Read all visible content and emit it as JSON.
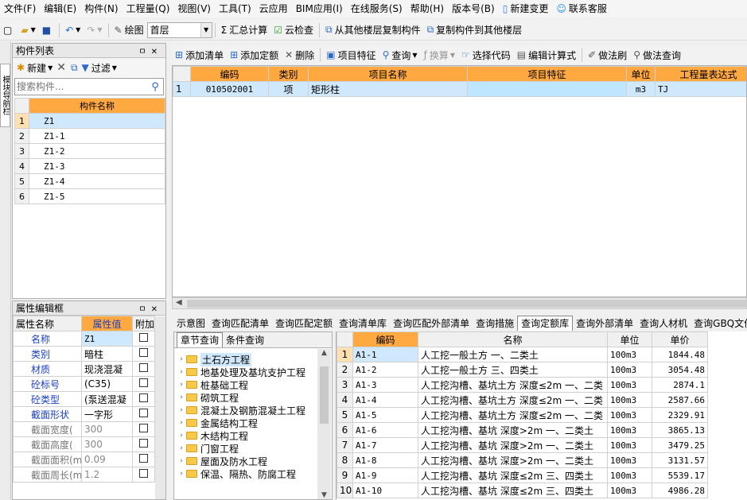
{
  "menu": [
    {
      "label": "文件(F)"
    },
    {
      "label": "编辑(E)"
    },
    {
      "label": "构件(N)"
    },
    {
      "label": "工程量(Q)"
    },
    {
      "label": "视图(V)"
    },
    {
      "label": "工具(T)"
    },
    {
      "label": "云应用"
    },
    {
      "label": "BIM应用(I)"
    },
    {
      "label": "在线服务(S)"
    },
    {
      "label": "帮助(H)"
    },
    {
      "label": "版本号(B)"
    },
    {
      "label": "新建变更",
      "icon": "document-icon"
    },
    {
      "label": "联系客服",
      "icon": "service-icon"
    }
  ],
  "toolbar1": {
    "draw_label": "绘图",
    "floor_value": "首层",
    "sum_label": "汇总计算",
    "cloud_check_label": "云检查",
    "copy_from_label": "从其他楼层复制构件",
    "copy_to_label": "复制构件到其他楼层"
  },
  "left_tab": {
    "label": "模块导航栏"
  },
  "component_list": {
    "title": "构件列表",
    "new_label": "新建",
    "filter_label": "过滤",
    "search_placeholder": "搜索构件...",
    "header": "构件名称",
    "rows": [
      {
        "n": "1",
        "name": "Z1"
      },
      {
        "n": "2",
        "name": "Z1-1"
      },
      {
        "n": "3",
        "name": "Z1-2"
      },
      {
        "n": "4",
        "name": "Z1-3"
      },
      {
        "n": "5",
        "name": "Z1-4"
      },
      {
        "n": "6",
        "name": "Z1-5"
      }
    ]
  },
  "properties": {
    "title": "属性编辑框",
    "headers": [
      "属性名称",
      "属性值",
      "附加"
    ],
    "rows": [
      {
        "name": "名称",
        "value": "Z1",
        "link": true
      },
      {
        "name": "类别",
        "value": "暗柱",
        "link": true
      },
      {
        "name": "材质",
        "value": "现浇混凝",
        "link": true
      },
      {
        "name": "砼标号",
        "value": "(C35)",
        "link": true
      },
      {
        "name": "砼类型",
        "value": "(泵送混凝",
        "link": true
      },
      {
        "name": "截面形状",
        "value": "一字形",
        "link": true
      },
      {
        "name": "截面宽度(",
        "value": "300",
        "link": false
      },
      {
        "name": "截面高度(",
        "value": "300",
        "link": false
      },
      {
        "name": "截面面积(m",
        "value": "0.09",
        "link": false
      },
      {
        "name": "截面周长(m",
        "value": "1.2",
        "link": false
      }
    ]
  },
  "toolbar2": {
    "add_list": "添加清单",
    "add_quota": "添加定额",
    "delete": "删除",
    "item_feature": "项目特征",
    "query": "查询",
    "convert": "换算",
    "select_code": "选择代码",
    "edit_formula": "编辑计算式",
    "method_brush": "做法刷",
    "method_query": "做法查询"
  },
  "top_grid": {
    "headers": [
      "编码",
      "类别",
      "项目名称",
      "项目特征",
      "单位",
      "工程量表达式"
    ],
    "rows": [
      {
        "n": "1",
        "code": "010502001",
        "type": "项",
        "name": "矩形柱",
        "feature": "",
        "unit": "m3",
        "expr": "TJ"
      }
    ]
  },
  "bottom_tabs": [
    {
      "label": "示意图"
    },
    {
      "label": "查询匹配清单"
    },
    {
      "label": "查询匹配定额"
    },
    {
      "label": "查询清单库"
    },
    {
      "label": "查询匹配外部清单"
    },
    {
      "label": "查询措施"
    },
    {
      "label": "查询定额库",
      "active": true
    },
    {
      "label": "查询外部清单"
    },
    {
      "label": "查询人材机"
    },
    {
      "label": "查询GBQ文件"
    }
  ],
  "query_tabs": [
    {
      "label": "章节查询",
      "active": true
    },
    {
      "label": "条件查询"
    }
  ],
  "tree": [
    {
      "label": "土石方工程",
      "selected": true
    },
    {
      "label": "地基处理及基坑支护工程"
    },
    {
      "label": "桩基础工程"
    },
    {
      "label": "砌筑工程"
    },
    {
      "label": "混凝土及钢筋混凝土工程"
    },
    {
      "label": "金属结构工程"
    },
    {
      "label": "木结构工程"
    },
    {
      "label": "门窗工程"
    },
    {
      "label": "屋面及防水工程"
    },
    {
      "label": "保温、隔热、防腐工程"
    }
  ],
  "quota_grid": {
    "headers": [
      "编码",
      "名称",
      "单位",
      "单价"
    ],
    "rows": [
      {
        "n": "1",
        "code": "A1-1",
        "name": "人工挖一般土方 一、二类土",
        "unit": "100m3",
        "price": "1844.48"
      },
      {
        "n": "2",
        "code": "A1-2",
        "name": "人工挖一般土方 三、四类土",
        "unit": "100m3",
        "price": "3054.48"
      },
      {
        "n": "3",
        "code": "A1-3",
        "name": "人工挖沟槽、基坑土方 深度≤2m 一、二类",
        "unit": "100m3",
        "price": "2874.1"
      },
      {
        "n": "4",
        "code": "A1-4",
        "name": "人工挖沟槽、基坑土方 深度≤2m 一、二类",
        "unit": "100m3",
        "price": "2587.66"
      },
      {
        "n": "5",
        "code": "A1-5",
        "name": "人工挖沟槽、基坑土方 深度≤2m 一、二类",
        "unit": "100m3",
        "price": "2329.91"
      },
      {
        "n": "6",
        "code": "A1-6",
        "name": "人工挖沟槽、基坑 深度>2m 一、二类土",
        "unit": "100m3",
        "price": "3865.13"
      },
      {
        "n": "7",
        "code": "A1-7",
        "name": "人工挖沟槽、基坑 深度>2m 一、二类土",
        "unit": "100m3",
        "price": "3479.25"
      },
      {
        "n": "8",
        "code": "A1-8",
        "name": "人工挖沟槽、基坑 深度>2m 一、二类土",
        "unit": "100m3",
        "price": "3131.57"
      },
      {
        "n": "9",
        "code": "A1-9",
        "name": "人工挖沟槽、基坑 深度≤2m 三、四类土",
        "unit": "100m3",
        "price": "5539.17"
      },
      {
        "n": "10",
        "code": "A1-10",
        "name": "人工挖沟槽、基坑 深度≤2m 三、四类土",
        "unit": "100m3",
        "price": "4986.28"
      }
    ]
  }
}
